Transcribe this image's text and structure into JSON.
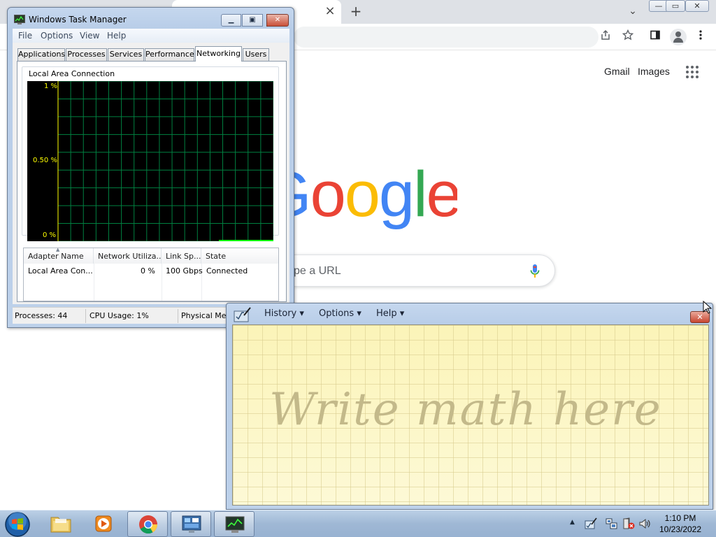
{
  "browser": {
    "tabstrip": {
      "new_tab_symbol": "+",
      "tab_close_symbol": "×",
      "tab_search_symbol": "⌄"
    },
    "window_buttons": {
      "minimize": "—",
      "maximize": "▭",
      "close": "✕"
    },
    "toolbar_icons": [
      "share-icon",
      "star-icon",
      "sidepanel-icon",
      "profile-icon",
      "kebab-menu-icon"
    ],
    "links": {
      "gmail": "Gmail",
      "images": "Images"
    },
    "logo_text": "Google",
    "search_placeholder": "pe a URL",
    "logo_colors": [
      "#4285F4",
      "#EA4335",
      "#FBBC05",
      "#4285F4",
      "#34A853",
      "#EA4335"
    ]
  },
  "task_manager": {
    "title": "Windows Task Manager",
    "menu": [
      "File",
      "Options",
      "View",
      "Help"
    ],
    "tabs": [
      "Applications",
      "Processes",
      "Services",
      "Performance",
      "Networking",
      "Users"
    ],
    "active_tab": "Networking",
    "graph": {
      "title": "Local Area Connection",
      "y_labels": [
        "1 %",
        "0.50 %",
        "0 %"
      ],
      "grid_color": "#008040",
      "line_color": "#00ff00",
      "max_utilization_percent": 1,
      "current_utilization_percent": 0
    },
    "adapter_table": {
      "columns": [
        "Adapter Name",
        "Network Utiliza...",
        "Link Sp...",
        "State"
      ],
      "rows": [
        {
          "adapter": "Local Area Con...",
          "utilization": "0 %",
          "link_speed": "100 Gbps",
          "state": "Connected"
        }
      ]
    },
    "status_bar": {
      "processes": "Processes: 44",
      "cpu": "CPU Usage: 1%",
      "memory": "Physical Mem"
    }
  },
  "math_input_panel": {
    "menu": [
      "History",
      "Options",
      "Help"
    ],
    "menu_arrow": "▾",
    "close_symbol": "✕",
    "hint": "Write math here",
    "paper_color": "#fcf6c2"
  },
  "taskbar": {
    "pinned": [
      "start-orb",
      "windows-explorer",
      "media-player",
      "google-chrome",
      "control-panel",
      "task-manager"
    ],
    "tray_icons": [
      "show-hidden-icons",
      "pen-input-icon",
      "network-icon",
      "action-center-icon",
      "volume-icon"
    ],
    "tray_arrow": "▲",
    "clock_time": "1:10 PM",
    "clock_date": "10/23/2022"
  }
}
